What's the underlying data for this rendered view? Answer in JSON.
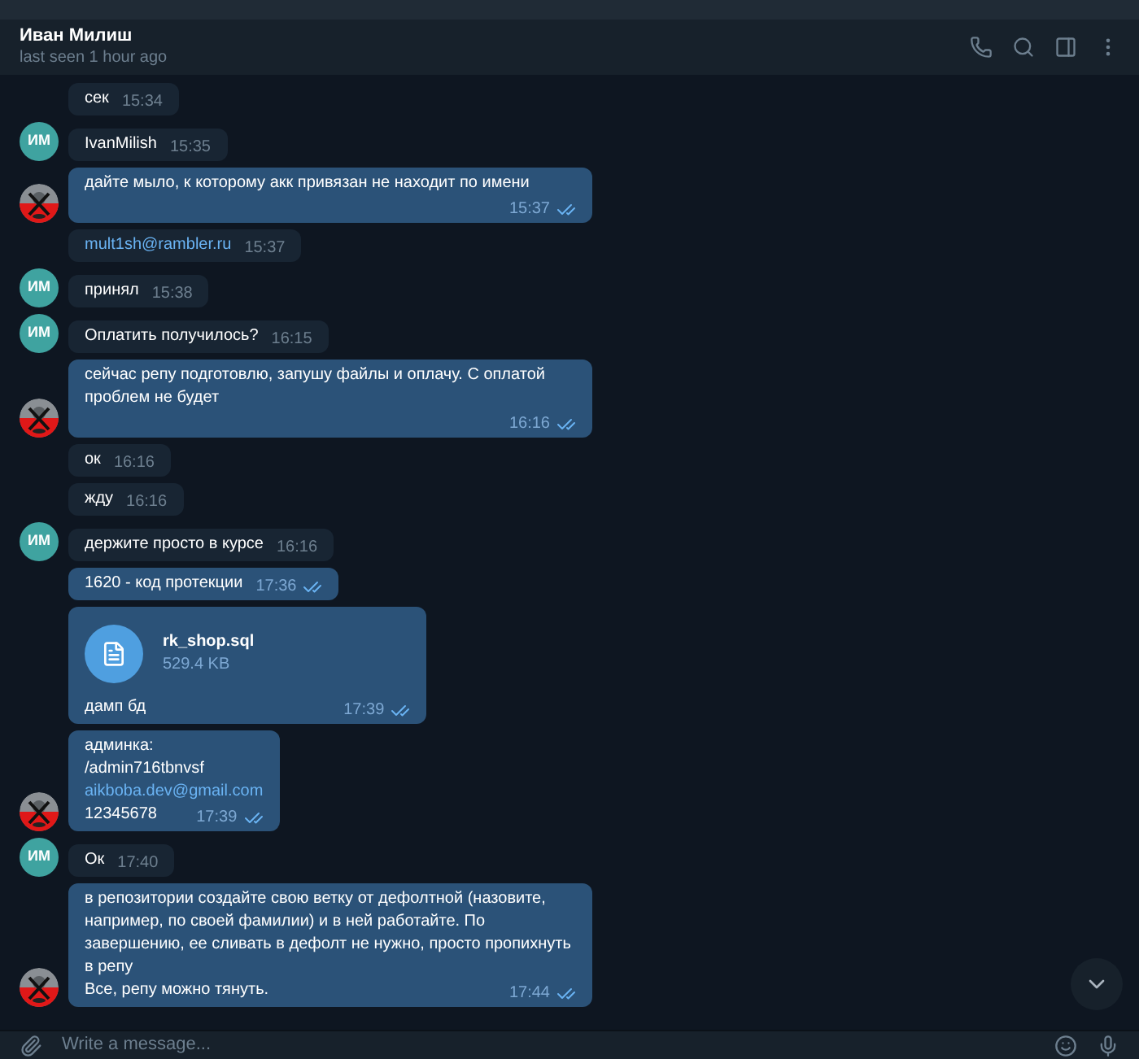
{
  "header": {
    "name": "Иван Милиш",
    "status": "last seen 1 hour ago"
  },
  "messages": [
    {
      "outgoing": false,
      "lines": [
        {
          "text": "сек",
          "link": false
        }
      ],
      "time": "15:34"
    },
    {
      "outgoing": false,
      "avatar": {
        "kind": "initials",
        "initials": "ИМ"
      },
      "lines": [
        {
          "text": "IvanMilish",
          "link": false
        }
      ],
      "time": "15:35"
    },
    {
      "outgoing": true,
      "avatar": {
        "kind": "picture"
      },
      "read": true,
      "lines": [
        {
          "text": "дайте мыло, к которому акк привязан не находит по имени",
          "link": false
        }
      ],
      "time": "15:37"
    },
    {
      "outgoing": false,
      "lines": [
        {
          "text": "mult1sh@rambler.ru",
          "link": true
        }
      ],
      "time": "15:37"
    },
    {
      "outgoing": false,
      "avatar": {
        "kind": "initials",
        "initials": "ИМ"
      },
      "lines": [
        {
          "text": "принял",
          "link": false
        }
      ],
      "time": "15:38"
    },
    {
      "outgoing": false,
      "avatar": {
        "kind": "initials",
        "initials": "ИМ"
      },
      "lines": [
        {
          "text": "Оплатить получилось?",
          "link": false
        }
      ],
      "time": "16:15"
    },
    {
      "outgoing": true,
      "avatar": {
        "kind": "picture"
      },
      "read": true,
      "lines": [
        {
          "text": "сейчас репу подготовлю, запушу файлы и оплачу. С оплатой проблем не будет",
          "link": false
        }
      ],
      "time": "16:16"
    },
    {
      "outgoing": false,
      "lines": [
        {
          "text": "ок",
          "link": false
        }
      ],
      "time": "16:16"
    },
    {
      "outgoing": false,
      "lines": [
        {
          "text": "жду",
          "link": false
        }
      ],
      "time": "16:16"
    },
    {
      "outgoing": false,
      "avatar": {
        "kind": "initials",
        "initials": "ИМ"
      },
      "lines": [
        {
          "text": "держите просто в курсе",
          "link": false
        }
      ],
      "time": "16:16"
    },
    {
      "outgoing": true,
      "read": true,
      "lines": [
        {
          "text": "1620 - код протекции",
          "link": false
        }
      ],
      "time": "17:36"
    },
    {
      "outgoing": true,
      "read": true,
      "file": {
        "name": "rk_shop.sql",
        "size": "529.4 KB"
      },
      "lines": [
        {
          "text": "дамп бд",
          "link": false
        }
      ],
      "time": "17:39"
    },
    {
      "outgoing": true,
      "avatar": {
        "kind": "picture"
      },
      "read": true,
      "lines": [
        {
          "text": "админка:",
          "link": false
        },
        {
          "text": "/admin716tbnvsf",
          "link": false
        },
        {
          "text": "aikboba.dev@gmail.com",
          "link": true
        },
        {
          "text": "12345678",
          "link": false
        }
      ],
      "time": "17:39"
    },
    {
      "outgoing": false,
      "avatar": {
        "kind": "initials",
        "initials": "ИМ"
      },
      "lines": [
        {
          "text": "Ок",
          "link": false
        }
      ],
      "time": "17:40"
    },
    {
      "outgoing": true,
      "avatar": {
        "kind": "picture"
      },
      "read": true,
      "lines": [
        {
          "text": "в репозитории создайте свою ветку от дефолтной (назовите, например, по своей фамилии) и в ней работайте. По завершению, ее сливать в дефолт не нужно, просто пропихнуть в репу",
          "link": false
        },
        {
          "text": "Все, репу можно тянуть.",
          "link": false
        }
      ],
      "time": "17:44"
    }
  ],
  "composer": {
    "placeholder": "Write a message..."
  }
}
